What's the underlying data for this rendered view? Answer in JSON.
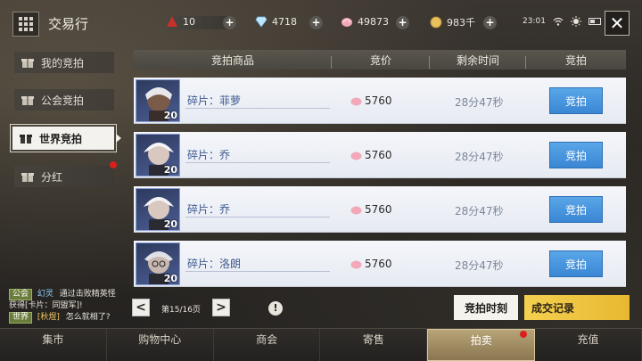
{
  "header": {
    "title": "交易行",
    "stamina": "10",
    "diamonds": "4718",
    "shells": "49873",
    "gold": "983千",
    "clock": "23:01"
  },
  "sidebar": {
    "items": [
      {
        "label": "我的竞拍"
      },
      {
        "label": "公会竞拍"
      },
      {
        "label": "世界竞拍"
      },
      {
        "label": "分红"
      }
    ]
  },
  "table": {
    "columns": [
      "竞拍商品",
      "竞价",
      "剩余时间",
      "竞拍"
    ],
    "rows": [
      {
        "name": "碎片：菲萝",
        "level": "20",
        "price": "5760",
        "time": "28分47秒",
        "action": "竞拍"
      },
      {
        "name": "碎片：乔",
        "level": "20",
        "price": "5760",
        "time": "28分47秒",
        "action": "竞拍"
      },
      {
        "name": "碎片：乔",
        "level": "20",
        "price": "5760",
        "time": "28分47秒",
        "action": "竞拍"
      },
      {
        "name": "碎片：洛朗",
        "level": "20",
        "price": "5760",
        "time": "28分47秒",
        "action": "竞拍"
      }
    ]
  },
  "pagination": {
    "prev": "<",
    "next": ">",
    "page_text": "第15/16页",
    "warn": "!"
  },
  "actions": {
    "auction_time": "竞拍时刻",
    "trade_record": "成交记录"
  },
  "chat": [
    {
      "tag": "公会",
      "name": "幻灵",
      "text": "通过击败精英怪"
    },
    {
      "tag": "",
      "name": "",
      "text": "获得[卡片：同盟军]!"
    },
    {
      "tag": "世界",
      "name": "[秋煜]",
      "text": "怎么就相了?"
    }
  ],
  "bottom_nav": [
    "集市",
    "购物中心",
    "商会",
    "寄售",
    "拍卖",
    "充值"
  ],
  "colors": {
    "bid_button": "#3a86d4",
    "active_nav": "#b8a478",
    "trade_record": "#f4d050"
  }
}
